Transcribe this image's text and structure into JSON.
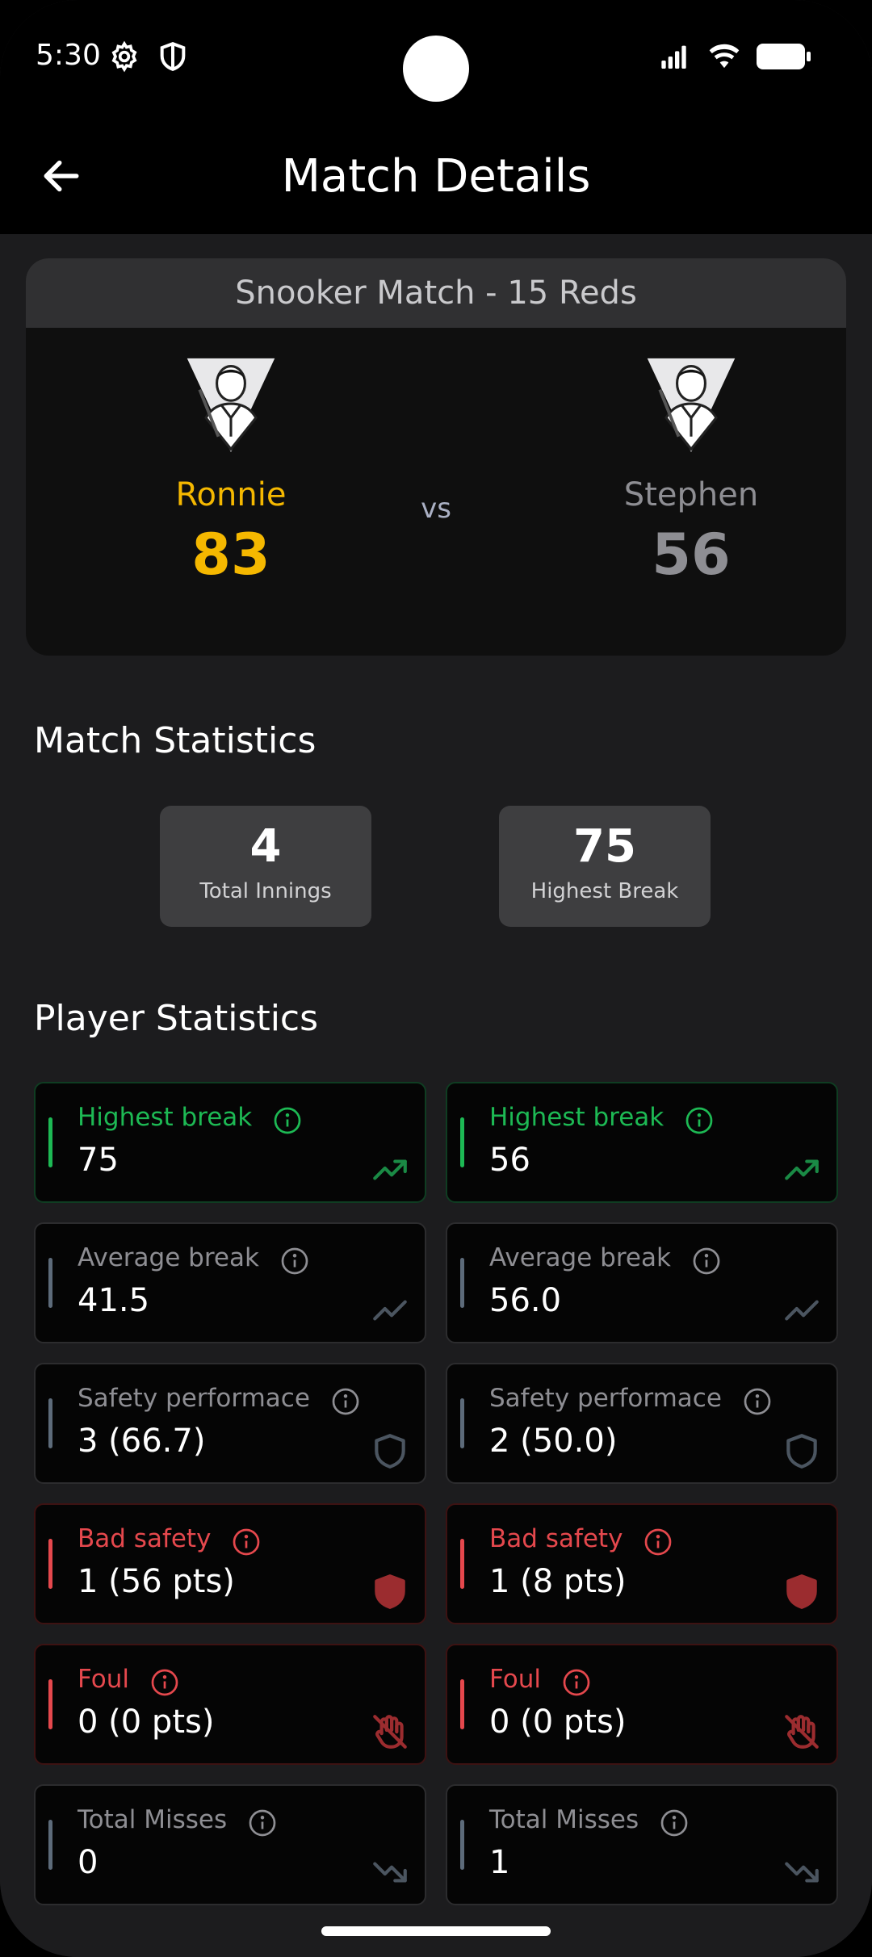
{
  "status_bar": {
    "time": "5:30"
  },
  "app_bar": {
    "title": "Match Details"
  },
  "match": {
    "header": "Snooker Match - 15 Reds",
    "vs": "vs",
    "player1": {
      "name": "Ronnie",
      "score": "83"
    },
    "player2": {
      "name": "Stephen",
      "score": "56"
    }
  },
  "match_stats": {
    "heading": "Match Statistics",
    "items": [
      {
        "value": "4",
        "label": "Total Innings"
      },
      {
        "value": "75",
        "label": "Highest Break"
      }
    ]
  },
  "player_stats": {
    "heading": "Player Statistics",
    "rows": [
      {
        "label": "Highest break",
        "p1": "75",
        "p2": "56",
        "tone": "green",
        "icon": "trending-up-icon"
      },
      {
        "label": "Average break",
        "p1": "41.5",
        "p2": "56.0",
        "tone": "gray",
        "icon": "trending-line-icon"
      },
      {
        "label": "Safety performace",
        "p1": "3 (66.7)",
        "p2": "2 (50.0)",
        "tone": "gray",
        "icon": "shield-icon"
      },
      {
        "label": "Bad safety",
        "p1": "1 (56 pts)",
        "p2": "1 (8 pts)",
        "tone": "red",
        "icon": "shield-filled-icon"
      },
      {
        "label": "Foul",
        "p1": "0 (0 pts)",
        "p2": "0 (0 pts)",
        "tone": "red",
        "icon": "hand-off-icon"
      },
      {
        "label": "Total Misses",
        "p1": "0",
        "p2": "1",
        "tone": "gray",
        "icon": "trending-down-icon"
      }
    ]
  },
  "colors": {
    "winner": "#f5b800",
    "loser": "#8e8e93",
    "green": "#1db954",
    "red": "#e5484d",
    "gray": "#8e8e93"
  }
}
